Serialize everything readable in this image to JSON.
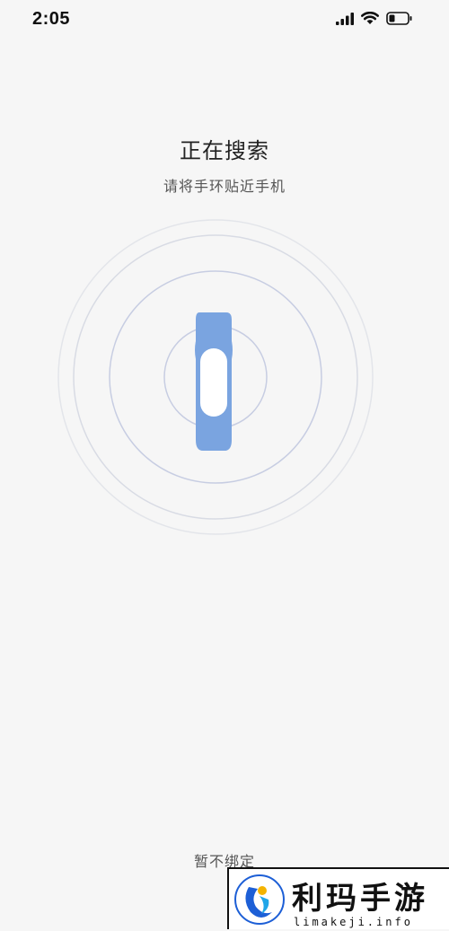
{
  "status_bar": {
    "time": "2:05",
    "signal_icon": "cellular-signal-icon",
    "wifi_icon": "wifi-icon",
    "battery_icon": "battery-icon"
  },
  "main": {
    "title": "正在搜索",
    "subtitle": "请将手环贴近手机",
    "illustration_icon": "fitness-band-icon",
    "skip_label": "暂不绑定"
  },
  "watermark": {
    "logo_text": "利玛手游",
    "site": "limakeji.info"
  },
  "colors": {
    "background": "#f6f6f6",
    "band_blue": "#7aa4e0",
    "ring": "#c7cde2"
  }
}
